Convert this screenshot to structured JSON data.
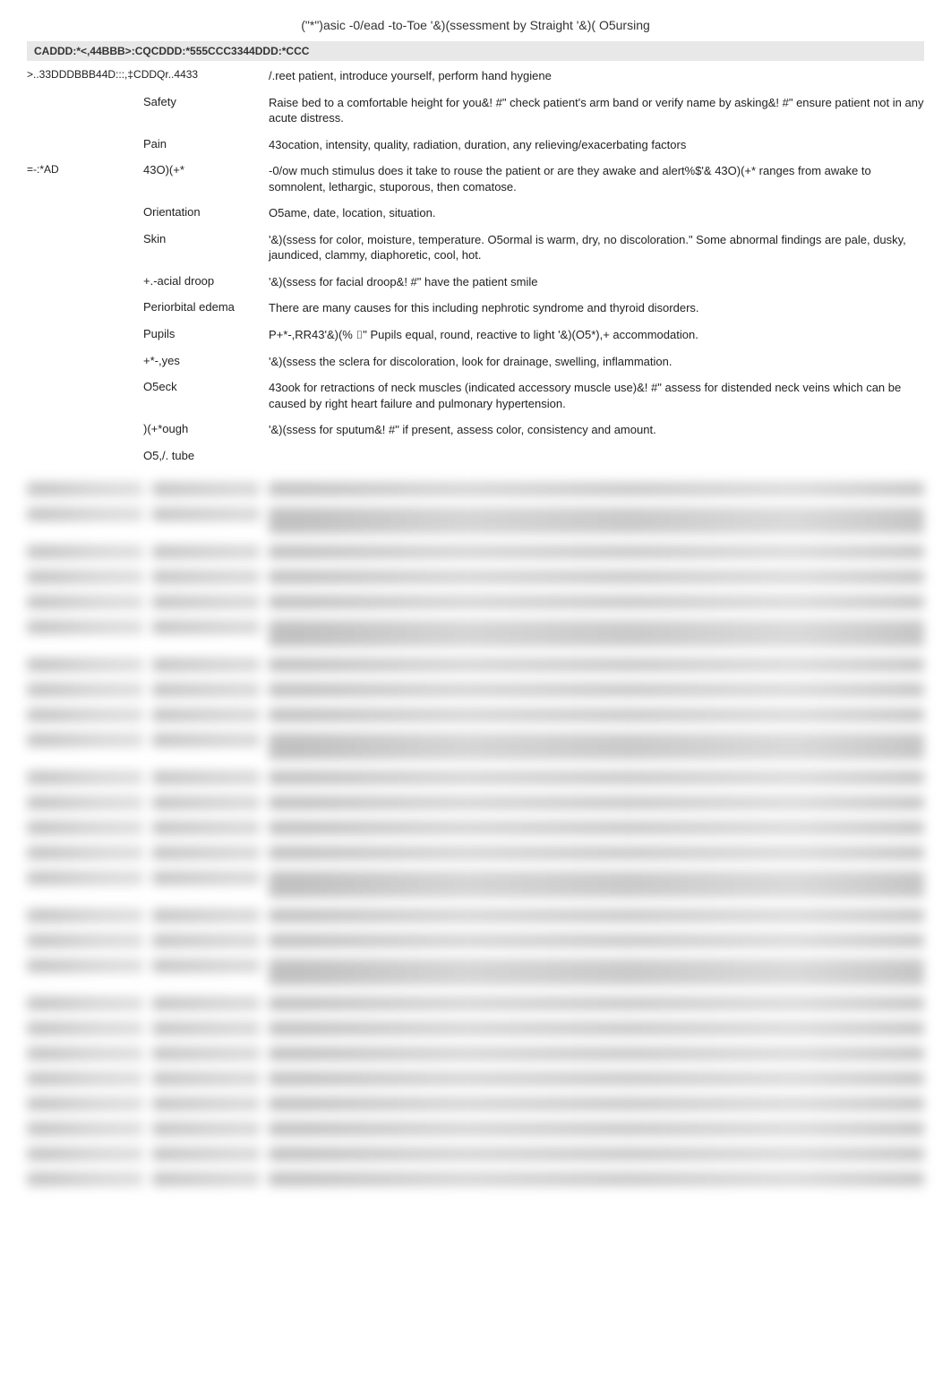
{
  "title": "(\"*\")asic -0/ead -to-Toe '&)(ssessment by Straight '&)( O5ursing",
  "header_bar": "CADDD:*<,44BBB>:CQCDDD:*555CCC3344DDD:*CCC",
  "left_group_label": ">..33DDDBBB44D:::,‡CDDQr..4433",
  "side_label": "=-:*AD",
  "rows": [
    {
      "label": "",
      "desc": "/.reet patient, introduce yourself, perform hand hygiene"
    },
    {
      "label": "Safety",
      "desc": "Raise bed to a comfortable height for you&! #\" check patient's arm band or verify name by asking&! #\" ensure patient not in any acute distress."
    },
    {
      "label": "Pain",
      "desc": "43ocation, intensity, quality, radiation, duration, any relieving/exacerbating factors"
    },
    {
      "label": "43O)(+*",
      "desc": "-0/ow much stimulus does it take to rouse the patient or are they awake and alert%$'& 43O)(+* ranges from awake to somnolent, lethargic, stuporous, then comatose."
    },
    {
      "label": "Orientation",
      "desc": "O5ame, date, location, situation."
    },
    {
      "label": "Skin",
      "desc": "'&)(ssess for color, moisture, temperature. O5ormal is warm, dry, no discoloration.\" Some abnormal findings are pale, dusky, jaundiced, clammy, diaphoretic, cool, hot."
    },
    {
      "label": "+.-acial droop",
      "desc": "'&)(ssess for facial droop&! #\" have the patient smile"
    },
    {
      "label": "Periorbital edema",
      "desc": "There are many causes for this including nephrotic syndrome and thyroid disorders."
    },
    {
      "label": "Pupils",
      "desc": "P+*-,RR43'&)(% ⌷\" Pupils equal, round, reactive to light '&)(O5*),+ accommodation."
    },
    {
      "label": "+*-,yes",
      "desc": "'&)(ssess the sclera for discoloration, look for drainage, swelling, inflammation."
    },
    {
      "label": "O5eck",
      "desc": "43ook for retractions of neck muscles (indicated accessory muscle use)&! #\" assess for distended neck veins which can be caused by right heart failure and pulmonary hypertension."
    },
    {
      "label": ")(+*ough",
      "desc": "'&)(ssess for sputum&! #\" if present, assess color, consistency and amount."
    },
    {
      "label": "O5,/. tube",
      "desc": ""
    }
  ]
}
